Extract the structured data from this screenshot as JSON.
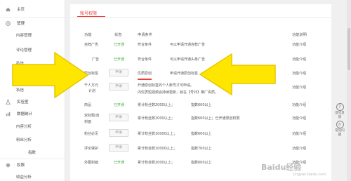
{
  "sidebar": {
    "home": "主页",
    "manage": "管理",
    "content_manage": "内容管理",
    "comment_manage": "评论管理",
    "item3": "私信",
    "item4": "粉丝",
    "privacy": "私信",
    "lab": "实验室",
    "data_stats": "数据统计",
    "content_analysis": "内容分析",
    "fan_analysis": "粉丝分析",
    "index": "指数",
    "permission": "权限",
    "revenue_manage": "收益分析"
  },
  "main": {
    "tab": "账号权限",
    "headers": {
      "feature": "功能",
      "status": "状态",
      "condition": "申请条件",
      "desc": "功能说明"
    },
    "rows": [
      {
        "feature": "自荐广告",
        "status": "已开通",
        "condition": "符合条件",
        "detail": "可以申请开通自荐广告",
        "intro": "功能介绍"
      },
      {
        "feature": "广告",
        "status": "已开通",
        "condition": "符合条件",
        "detail": "可以申请开通头条广告",
        "intro": "功能介绍"
      },
      {
        "feature": "原创标签",
        "status": "申请",
        "condition": "优质原创",
        "detail": "申请开通原创标签",
        "intro": "功能介绍"
      },
      {
        "feature": "千人万元",
        "feature2": "计划",
        "status": "申请",
        "condition": "开通原创标签的个人账号才可申请。",
        "condition2": "内优质短视频会持续更新，就在【号外】推广资质。",
        "intro": "功能介绍"
      },
      {
        "feature": "商品",
        "status": "已开通",
        "condition": "累计粉丝数2000以上；",
        "detail": "指数600以上",
        "intro": "功能介绍"
      },
      {
        "feature": "双标题/双",
        "feature2": "封面",
        "status": "申请",
        "condition": "累计粉丝数2000以上；",
        "detail": "指数600以上；已开通原创权限",
        "intro": "功能介绍"
      },
      {
        "feature": "粉丝必见",
        "status": "申请",
        "condition": "累计粉丝数10000以上；",
        "detail": "指数600以上",
        "intro": "功能介绍"
      },
      {
        "feature": "评论保护",
        "status": "申请",
        "condition": "累计粉丝数10000以上；",
        "detail": "指数700以上",
        "intro": "功能介绍"
      },
      {
        "feature": "外图封面",
        "status": "已开通",
        "condition": "累计粉丝数2000以上；",
        "detail": "指数600以上",
        "intro": "功能介绍"
      }
    ]
  },
  "right_tools": {
    "feedback": "意见反馈",
    "faq": "常见问题"
  },
  "watermark": {
    "brand": "Baidu经验",
    "url": "jingyan.baidu.com"
  },
  "colors": {
    "accent": "#e8413a",
    "on": "#3fae3f",
    "arrow": "#ffe600"
  }
}
